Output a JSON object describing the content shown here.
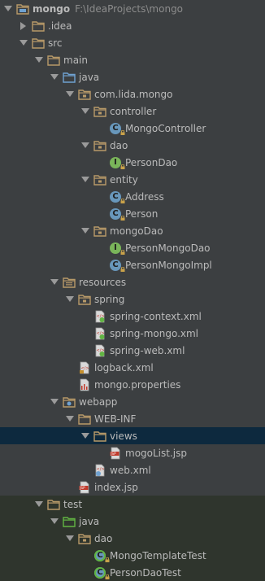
{
  "project": {
    "name": "mongo",
    "path": "F:\\IdeaProjects\\mongo"
  },
  "nodes": [
    {
      "label": "mongo",
      "icon": "module-folder-icon",
      "depth": 0,
      "arrow": "down",
      "kind": "project"
    },
    {
      "label": ".idea",
      "icon": "folder-icon",
      "depth": 1,
      "arrow": "right"
    },
    {
      "label": "src",
      "icon": "folder-icon",
      "depth": 1,
      "arrow": "down"
    },
    {
      "label": "main",
      "icon": "folder-icon",
      "depth": 2,
      "arrow": "down"
    },
    {
      "label": "java",
      "icon": "source-folder-icon",
      "depth": 3,
      "arrow": "down"
    },
    {
      "label": "com.lida.mongo",
      "icon": "package-icon",
      "depth": 4,
      "arrow": "down"
    },
    {
      "label": "controller",
      "icon": "package-icon",
      "depth": 5,
      "arrow": "down"
    },
    {
      "label": "MongoController",
      "icon": "class-icon",
      "depth": 6,
      "arrow": "none"
    },
    {
      "label": "dao",
      "icon": "package-icon",
      "depth": 5,
      "arrow": "down"
    },
    {
      "label": "PersonDao",
      "icon": "interface-icon",
      "depth": 6,
      "arrow": "none"
    },
    {
      "label": "entity",
      "icon": "package-icon",
      "depth": 5,
      "arrow": "down"
    },
    {
      "label": "Address",
      "icon": "class-icon",
      "depth": 6,
      "arrow": "none"
    },
    {
      "label": "Person",
      "icon": "class-icon",
      "depth": 6,
      "arrow": "none"
    },
    {
      "label": "mongoDao",
      "icon": "package-icon",
      "depth": 5,
      "arrow": "down"
    },
    {
      "label": "PersonMongoDao",
      "icon": "interface-icon",
      "depth": 6,
      "arrow": "none"
    },
    {
      "label": "PersonMongoImpl",
      "icon": "class-icon",
      "depth": 6,
      "arrow": "none"
    },
    {
      "label": "resources",
      "icon": "resources-folder-icon",
      "depth": 3,
      "arrow": "down"
    },
    {
      "label": "spring",
      "icon": "package-icon",
      "depth": 4,
      "arrow": "down"
    },
    {
      "label": "spring-context.xml",
      "icon": "spring-xml-icon",
      "depth": 5,
      "arrow": "none"
    },
    {
      "label": "spring-mongo.xml",
      "icon": "spring-xml-icon",
      "depth": 5,
      "arrow": "none"
    },
    {
      "label": "spring-web.xml",
      "icon": "spring-xml-icon",
      "depth": 5,
      "arrow": "none"
    },
    {
      "label": "logback.xml",
      "icon": "xml-file-icon",
      "depth": 4,
      "arrow": "none"
    },
    {
      "label": "mongo.properties",
      "icon": "properties-file-icon",
      "depth": 4,
      "arrow": "none"
    },
    {
      "label": "webapp",
      "icon": "web-folder-icon",
      "depth": 3,
      "arrow": "down"
    },
    {
      "label": "WEB-INF",
      "icon": "folder-icon",
      "depth": 4,
      "arrow": "down"
    },
    {
      "label": "views",
      "icon": "folder-icon",
      "depth": 5,
      "arrow": "down",
      "selected": true
    },
    {
      "label": "mogoList.jsp",
      "icon": "jsp-file-icon",
      "depth": 6,
      "arrow": "none"
    },
    {
      "label": "web.xml",
      "icon": "web-xml-icon",
      "depth": 5,
      "arrow": "none"
    },
    {
      "label": "index.jsp",
      "icon": "jsp-file-icon",
      "depth": 4,
      "arrow": "none"
    },
    {
      "label": "test",
      "icon": "folder-icon",
      "depth": 2,
      "arrow": "down",
      "test": true
    },
    {
      "label": "java",
      "icon": "test-source-folder-icon",
      "depth": 3,
      "arrow": "down",
      "test": true
    },
    {
      "label": "dao",
      "icon": "package-icon",
      "depth": 4,
      "arrow": "down",
      "test": true
    },
    {
      "label": "MongoTemplateTest",
      "icon": "test-class-icon",
      "depth": 5,
      "arrow": "none",
      "test": true
    },
    {
      "label": "PersonDaoTest",
      "icon": "test-class-icon",
      "depth": 5,
      "arrow": "none",
      "test": true
    }
  ],
  "colors": {
    "background": "#3c3f41",
    "selection": "#0d293e",
    "test_background": "#2f352d",
    "folder": "#b89a69",
    "source_folder": "#6fa2d1",
    "test_folder": "#62b543",
    "class": "#6897bb",
    "interface": "#7ab55a"
  }
}
